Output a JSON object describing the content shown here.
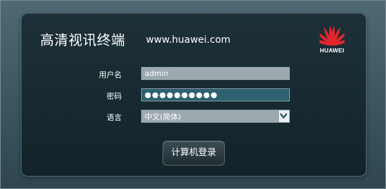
{
  "header": {
    "title": "高清视讯终端",
    "url": "www.huawei.com"
  },
  "logo": {
    "brand": "HUAWEI",
    "icon": "huawei-petal-logo",
    "color": "#e3262b"
  },
  "form": {
    "username_label": "用户名",
    "username_value": "admin",
    "password_label": "密码",
    "password_value": "●●●●●●●●●●",
    "language_label": "语言",
    "language_value": "中文(简体)",
    "login_label": "计算机登录"
  },
  "icons": {
    "dropdown": "chevron-down-icon"
  }
}
